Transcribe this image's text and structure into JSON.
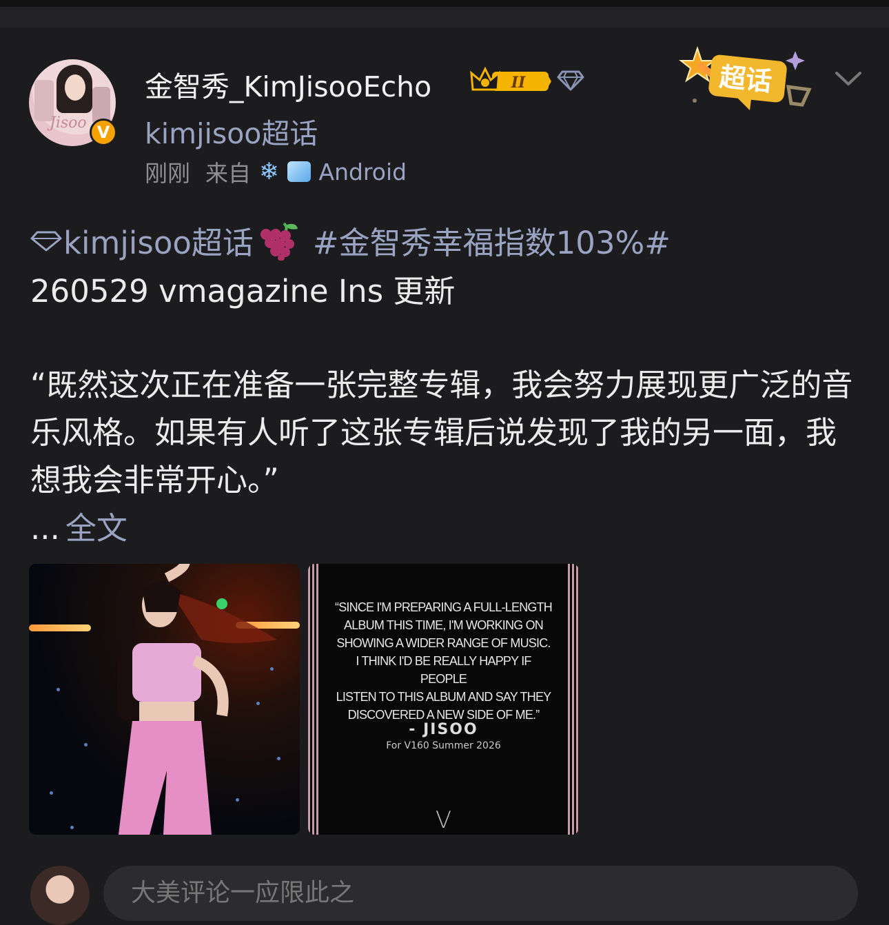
{
  "post": {
    "author": {
      "name": "金智秀_KimJisooEcho",
      "level_badge": "II",
      "topic": "kimjisoo超话"
    },
    "meta": {
      "time": "刚刚",
      "from_label": "来自",
      "client": "Android"
    },
    "supertopic_badge_label": "超话",
    "content": {
      "topic_link": "kimjisoo超话",
      "hashtag": "#金智秀幸福指数103%#",
      "headline": "260529 vmagazine  Ins 更新",
      "quote": "“既然这次正在准备一张完整专辑，我会努力展现更广泛的音乐风格。如果有人听了这张专辑后说发现了我的另一面，我想我会非常开心。”",
      "ellipsis": "...",
      "expand_label": "全文"
    },
    "images": [
      {
        "description_icon": "photo-jisoo-pink-outfit"
      },
      {
        "quote_lines": [
          "“SINCE I'M PREPARING A FULL-LENGTH",
          "ALBUM THIS TIME, I'M WORKING ON",
          "SHOWING A WIDER RANGE OF MUSIC.",
          "I THINK I'D BE REALLY HAPPY IF PEOPLE",
          "LISTEN TO THIS ALBUM AND SAY THEY",
          "DISCOVERED A NEW SIDE OF ME.”"
        ],
        "author": "- JISOO",
        "credit": "For V160 Summer 2026",
        "mark": "V"
      }
    ]
  },
  "comment_bar": {
    "placeholder": "大美评论一应限此之"
  },
  "colors": {
    "background": "#1c1c1e",
    "link": "#9aa4c2",
    "verified": "#f5a200",
    "badge_gold": "#f5b400"
  }
}
